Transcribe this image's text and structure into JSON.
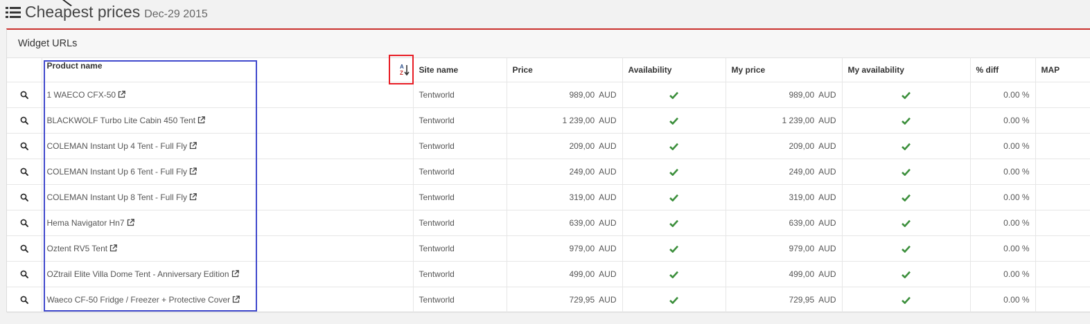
{
  "header": {
    "title": "Cheapest prices",
    "date": "Dec-29 2015"
  },
  "panel": {
    "title": "Widget URLs"
  },
  "table": {
    "columns": {
      "product": "Product name",
      "site": "Site name",
      "price": "Price",
      "availability": "Availability",
      "my_price": "My price",
      "my_availability": "My availability",
      "diff": "% diff",
      "map": "MAP"
    },
    "rows": [
      {
        "product": "1 WAECO CFX-50",
        "site": "Tentworld",
        "price": "989,00",
        "currency": "AUD",
        "my_price": "989,00",
        "my_currency": "AUD",
        "diff": "0.00 %"
      },
      {
        "product": "BLACKWOLF Turbo Lite Cabin 450 Tent",
        "site": "Tentworld",
        "price": "1 239,00",
        "currency": "AUD",
        "my_price": "1 239,00",
        "my_currency": "AUD",
        "diff": "0.00 %"
      },
      {
        "product": "COLEMAN Instant Up 4 Tent - Full Fly",
        "site": "Tentworld",
        "price": "209,00",
        "currency": "AUD",
        "my_price": "209,00",
        "my_currency": "AUD",
        "diff": "0.00 %"
      },
      {
        "product": "COLEMAN Instant Up 6 Tent - Full Fly",
        "site": "Tentworld",
        "price": "249,00",
        "currency": "AUD",
        "my_price": "249,00",
        "my_currency": "AUD",
        "diff": "0.00 %"
      },
      {
        "product": "COLEMAN Instant Up 8 Tent - Full Fly",
        "site": "Tentworld",
        "price": "319,00",
        "currency": "AUD",
        "my_price": "319,00",
        "my_currency": "AUD",
        "diff": "0.00 %"
      },
      {
        "product": "Hema Navigator Hn7",
        "site": "Tentworld",
        "price": "639,00",
        "currency": "AUD",
        "my_price": "639,00",
        "my_currency": "AUD",
        "diff": "0.00 %"
      },
      {
        "product": "Oztent RV5 Tent",
        "site": "Tentworld",
        "price": "979,00",
        "currency": "AUD",
        "my_price": "979,00",
        "my_currency": "AUD",
        "diff": "0.00 %"
      },
      {
        "product": "OZtrail Elite Villa Dome Tent - Anniversary Edition",
        "site": "Tentworld",
        "price": "499,00",
        "currency": "AUD",
        "my_price": "499,00",
        "my_currency": "AUD",
        "diff": "0.00 %"
      },
      {
        "product": "Waeco CF-50 Fridge / Freezer + Protective Cover",
        "site": "Tentworld",
        "price": "729,95",
        "currency": "AUD",
        "my_price": "729,95",
        "my_currency": "AUD",
        "diff": "0.00 %"
      }
    ]
  },
  "colors": {
    "accent_red": "#c9302c",
    "check_green": "#3c8f3c",
    "highlight_blue": "#3f48cc",
    "highlight_red": "#e81c24"
  }
}
